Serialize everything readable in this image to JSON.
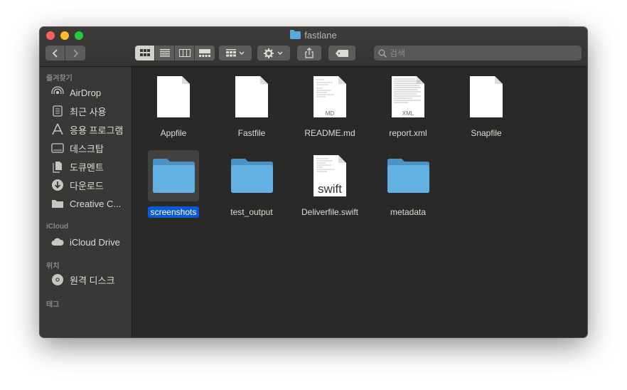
{
  "window": {
    "title": "fastlane"
  },
  "search": {
    "placeholder": "검색"
  },
  "sidebar": {
    "favorites_header": "즐겨찾기",
    "favorites": [
      {
        "label": "AirDrop",
        "icon": "airdrop-icon"
      },
      {
        "label": "최근 사용",
        "icon": "recents-icon"
      },
      {
        "label": "응용 프로그램",
        "icon": "applications-icon"
      },
      {
        "label": "데스크탑",
        "icon": "desktop-icon"
      },
      {
        "label": "도큐멘트",
        "icon": "documents-icon"
      },
      {
        "label": "다운로드",
        "icon": "downloads-icon"
      },
      {
        "label": "Creative C...",
        "icon": "folder-icon"
      }
    ],
    "icloud_header": "iCloud",
    "icloud": [
      {
        "label": "iCloud Drive",
        "icon": "cloud-icon"
      }
    ],
    "locations_header": "위치",
    "locations": [
      {
        "label": "원격 디스크",
        "icon": "remote-disc-icon"
      }
    ],
    "tags_header": "태그"
  },
  "files": [
    {
      "name": "Appfile",
      "kind": "blank-document",
      "badge": ""
    },
    {
      "name": "Fastfile",
      "kind": "blank-document",
      "badge": ""
    },
    {
      "name": "README.md",
      "kind": "text-document",
      "badge": "MD"
    },
    {
      "name": "report.xml",
      "kind": "text-document",
      "badge": "XML"
    },
    {
      "name": "Snapfile",
      "kind": "blank-document",
      "badge": ""
    },
    {
      "name": "screenshots",
      "kind": "folder",
      "badge": "",
      "selected": true
    },
    {
      "name": "test_output",
      "kind": "folder",
      "badge": ""
    },
    {
      "name": "Deliverfile.swift",
      "kind": "swift-document",
      "badge": "swift"
    },
    {
      "name": "metadata",
      "kind": "folder",
      "badge": ""
    }
  ],
  "colors": {
    "folder_blue": "#5aa9d9",
    "selection_blue": "#0a5bd1",
    "window_bg": "#2b2927",
    "sidebar_bg": "#3a3836"
  }
}
